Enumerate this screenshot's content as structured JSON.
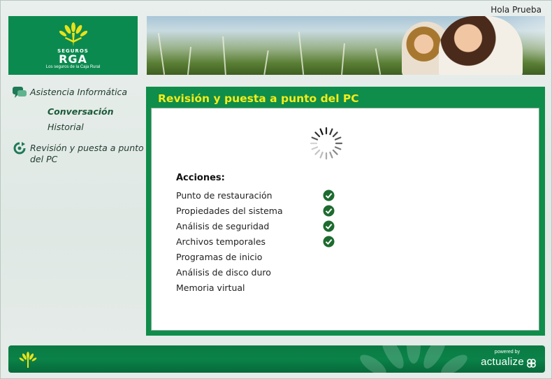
{
  "header": {
    "greeting": "Hola Prueba",
    "logo": {
      "brand_small": "SEGUROS",
      "brand": "RGA",
      "tagline": "Los seguros de la Caja Rural"
    }
  },
  "sidebar": {
    "sections": [
      {
        "label": "Asistencia Informática",
        "icon": "chat-bubbles-icon",
        "items": [
          {
            "label": "Conversación",
            "active": true
          },
          {
            "label": "Historial",
            "active": false
          }
        ]
      },
      {
        "label": "Revisión y puesta a punto del PC",
        "icon": "refresh-icon"
      }
    ]
  },
  "main": {
    "title": "Revisión y puesta a punto del PC",
    "status": "loading",
    "actions_title": "Acciones:",
    "actions": [
      {
        "label": "Punto de restauración",
        "done": true
      },
      {
        "label": "Propiedades del sistema",
        "done": true
      },
      {
        "label": "Análisis de seguridad",
        "done": true
      },
      {
        "label": "Archivos temporales",
        "done": true
      },
      {
        "label": "Programas de inicio",
        "done": false
      },
      {
        "label": "Análisis de disco duro",
        "done": false
      },
      {
        "label": "Memoria virtual",
        "done": false
      }
    ]
  },
  "footer": {
    "powered_by": "powered by",
    "brand": "actualize"
  },
  "colors": {
    "brand_green": "#0b8a4f",
    "title_yellow": "#f4ec1b",
    "check_green": "#1d6b2f"
  }
}
